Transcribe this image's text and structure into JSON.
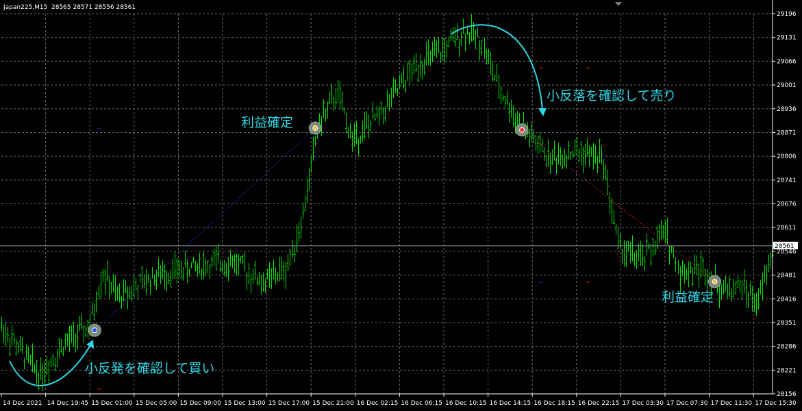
{
  "header": {
    "symbol": "Japan225,M15",
    "ohlc": "28565 28571 28556 28561"
  },
  "colors": {
    "background": "#000000",
    "grid": "#6b6b6b",
    "bar": "#00e000",
    "annotation": "#2fd8e6",
    "axis_text": "#ffffff",
    "price_line": "#8a9aa8"
  },
  "chart_data": {
    "type": "bar",
    "style": "ohlc",
    "timeframe": "M15",
    "ylim": [
      28156,
      29196
    ],
    "y_ticks": [
      "29196",
      "29131",
      "29066",
      "29001",
      "28936",
      "28871",
      "28806",
      "28741",
      "28676",
      "28611",
      "28546",
      "28481",
      "28416",
      "28351",
      "28286",
      "28221",
      "28156"
    ],
    "x_ticks": [
      "14 Dec 2021",
      "14 Dec 19:45",
      "15 Dec 01:00",
      "15 Dec 05:00",
      "15 Dec 09:00",
      "15 Dec 13:00",
      "15 Dec 17:00",
      "15 Dec 21:00",
      "16 Dec 02:15",
      "16 Dec 06:15",
      "16 Dec 10:15",
      "16 Dec 14:15",
      "16 Dec 18:15",
      "16 Dec 22:15",
      "17 Dec 03:30",
      "17 Dec 07:30",
      "17 Dec 11:30",
      "17 Dec 15:30"
    ],
    "current_price": "28561",
    "price_path": [
      {
        "x": 0,
        "y": 28340
      },
      {
        "x": 0.03,
        "y": 28260
      },
      {
        "x": 0.05,
        "y": 28210
      },
      {
        "x": 0.08,
        "y": 28290
      },
      {
        "x": 0.115,
        "y": 28340
      },
      {
        "x": 0.13,
        "y": 28490
      },
      {
        "x": 0.15,
        "y": 28420
      },
      {
        "x": 0.2,
        "y": 28480
      },
      {
        "x": 0.24,
        "y": 28500
      },
      {
        "x": 0.3,
        "y": 28520
      },
      {
        "x": 0.34,
        "y": 28460
      },
      {
        "x": 0.37,
        "y": 28500
      },
      {
        "x": 0.39,
        "y": 28640
      },
      {
        "x": 0.41,
        "y": 28890
      },
      {
        "x": 0.435,
        "y": 28980
      },
      {
        "x": 0.455,
        "y": 28850
      },
      {
        "x": 0.49,
        "y": 28920
      },
      {
        "x": 0.54,
        "y": 29060
      },
      {
        "x": 0.57,
        "y": 29090
      },
      {
        "x": 0.6,
        "y": 29150
      },
      {
        "x": 0.62,
        "y": 29130
      },
      {
        "x": 0.645,
        "y": 28990
      },
      {
        "x": 0.67,
        "y": 28900
      },
      {
        "x": 0.71,
        "y": 28800
      },
      {
        "x": 0.745,
        "y": 28820
      },
      {
        "x": 0.78,
        "y": 28800
      },
      {
        "x": 0.8,
        "y": 28560
      },
      {
        "x": 0.83,
        "y": 28520
      },
      {
        "x": 0.86,
        "y": 28600
      },
      {
        "x": 0.88,
        "y": 28490
      },
      {
        "x": 0.91,
        "y": 28500
      },
      {
        "x": 0.935,
        "y": 28440
      },
      {
        "x": 0.96,
        "y": 28450
      },
      {
        "x": 0.98,
        "y": 28400
      },
      {
        "x": 1.0,
        "y": 28550
      }
    ],
    "trades": [
      {
        "type": "buy_entry",
        "x": 0.121,
        "price": 28330
      },
      {
        "type": "buy_exit",
        "x": 0.407,
        "price": 28883
      },
      {
        "type": "sell_entry",
        "x": 0.675,
        "price": 28878
      },
      {
        "type": "sell_exit",
        "x": 0.925,
        "price": 28463
      }
    ]
  },
  "annotations": {
    "buy_signal": "小反発を確認して買い",
    "take_profit_1": "利益確定",
    "sell_signal": "小反落を確認して売り",
    "take_profit_2": "利益確定"
  }
}
